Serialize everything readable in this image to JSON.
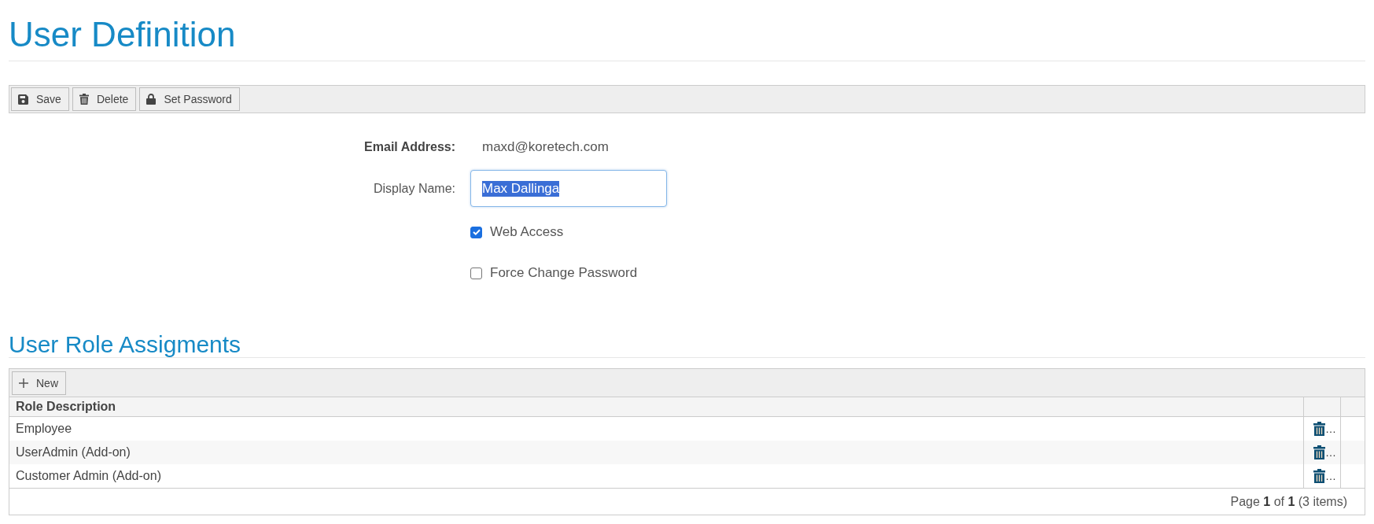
{
  "page": {
    "title": "User Definition"
  },
  "toolbar": {
    "buttons": [
      {
        "kind": "save",
        "label": "Save"
      },
      {
        "kind": "delete",
        "label": "Delete"
      },
      {
        "kind": "password",
        "label": "Set Password"
      }
    ]
  },
  "form": {
    "fields": [
      {
        "kind": "text",
        "label": "Email Address:",
        "value": "maxd@koretech.com"
      },
      {
        "kind": "input",
        "label": "Display Name:",
        "value": "Max Dallinga",
        "focused": true,
        "text_selected": true
      },
      {
        "kind": "checkbox",
        "label": "Web Access",
        "checked": true
      },
      {
        "kind": "checkbox",
        "label": "Force Change Password",
        "checked": false
      }
    ]
  },
  "roles": {
    "title": "User Role Assigments",
    "toolbar": {
      "buttons": [
        {
          "kind": "new",
          "label": "New"
        }
      ]
    },
    "columns": [
      "Role Description"
    ],
    "rows": [
      {
        "description": "Employee",
        "action_text": "…"
      },
      {
        "description": "UserAdmin (Add-on)",
        "action_text": "…"
      },
      {
        "description": "Customer Admin (Add-on)",
        "action_text": "…"
      }
    ],
    "pager": "Page **1** of **1** (3 items)"
  }
}
